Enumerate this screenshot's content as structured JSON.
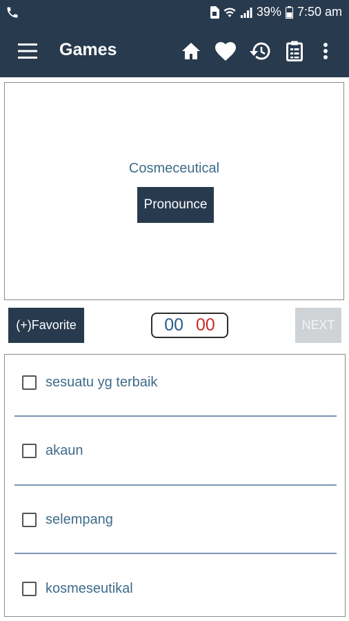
{
  "status_bar": {
    "battery": "39%",
    "time": "7:50 am",
    "icons": [
      "phone-icon",
      "sim-icon",
      "wifi-icon",
      "signal-icon",
      "battery-icon"
    ]
  },
  "toolbar": {
    "title": "Games",
    "icons": [
      "menu-icon",
      "home-icon",
      "heart-icon",
      "history-icon",
      "clipboard-icon",
      "more-vert-icon"
    ]
  },
  "card": {
    "word": "Cosmeceutical",
    "pronounce_label": "Pronounce"
  },
  "controls": {
    "favorite_label": "(+)Favorite",
    "timer_minutes": "00",
    "timer_seconds": "00",
    "next_label": "NEXT"
  },
  "options": [
    {
      "label": "sesuatu yg terbaik",
      "checked": false
    },
    {
      "label": "akaun",
      "checked": false
    },
    {
      "label": "selempang",
      "checked": false
    },
    {
      "label": "kosmeseutikal",
      "checked": false
    }
  ],
  "colors": {
    "primary": "#283a4e",
    "word": "#3e6b8a",
    "timer_minutes": "#2a5a8a",
    "timer_seconds": "#cc2a2a",
    "divider": "#7d92b6",
    "next_disabled": "#cfd3d6"
  }
}
